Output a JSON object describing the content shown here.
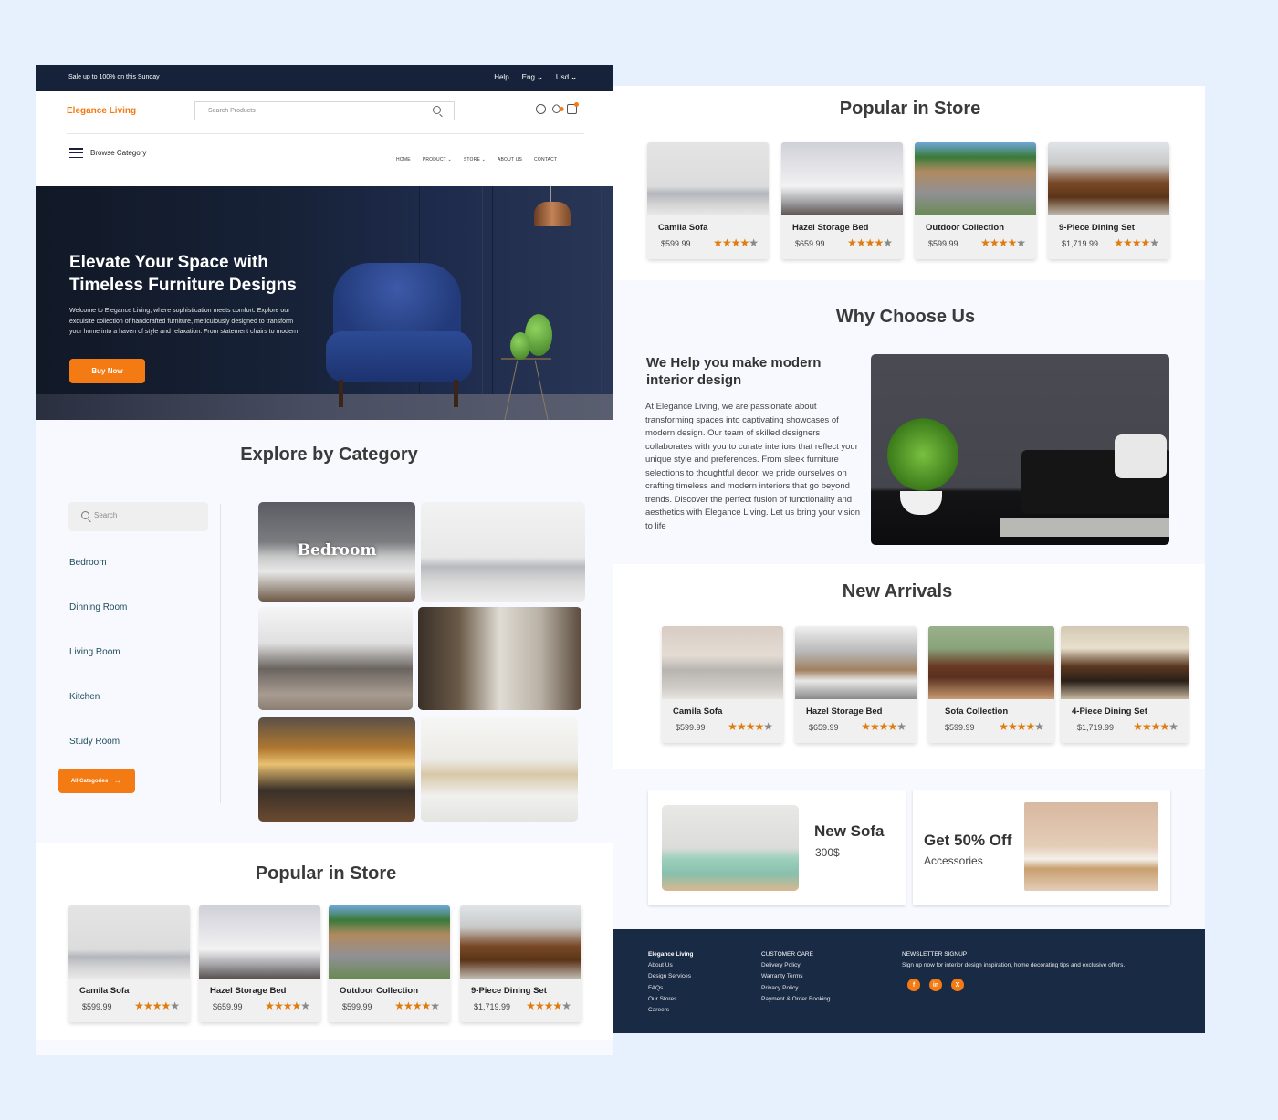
{
  "topbar": {
    "promo": "Sale up to 100% on this Sunday",
    "help": "Help",
    "language": "Eng",
    "currency": "Usd"
  },
  "header": {
    "logo": "Elegance Living",
    "search_placeholder": "Search Products",
    "browse": "Browse Category",
    "nav": [
      {
        "label": "HOME",
        "dropdown": false
      },
      {
        "label": "PRODUCT",
        "dropdown": true
      },
      {
        "label": "STORE",
        "dropdown": true
      },
      {
        "label": "ABOUT US",
        "dropdown": false
      },
      {
        "label": "CONTACT",
        "dropdown": false
      }
    ],
    "icons": [
      "user-icon",
      "heart-icon",
      "bag-icon"
    ]
  },
  "hero": {
    "title": "Elevate Your Space with Timeless Furniture Designs",
    "description": "Welcome to Elegance Living, where sophistication meets comfort. Explore our exquisite collection of handcrafted furniture, meticulously designed to transform your home into a haven of style and relaxation. From statement chairs to modern",
    "cta": "Buy Now"
  },
  "categories": {
    "title": "Explore by Category",
    "search_placeholder": "Search",
    "items": [
      "Bedroom",
      "Dinning Room",
      "Living Room",
      "Kitchen",
      "Study Room"
    ],
    "button": "All Categories",
    "tile_label": "Bedroom"
  },
  "popular": {
    "title": "Popular in Store",
    "products": [
      {
        "name": "Camila Sofa",
        "price": "$599.99",
        "rating": 4
      },
      {
        "name": "Hazel Storage Bed",
        "price": "$659.99",
        "rating": 4
      },
      {
        "name": "Outdoor Collection",
        "price": "$599.99",
        "rating": 4
      },
      {
        "name": "9-Piece Dining Set",
        "price": "$1,719.99",
        "rating": 4
      }
    ]
  },
  "why": {
    "title": "Why Choose Us",
    "heading": "We Help you make modern interior design",
    "body": "At Elegance Living, we are passionate about transforming spaces into captivating showcases of modern design. Our team of skilled designers collaborates with you to curate interiors that reflect your unique style and preferences. From sleek furniture selections to thoughtful decor, we pride ourselves on crafting timeless and modern interiors that go beyond trends. Discover the perfect fusion of functionality and aesthetics with Elegance Living. Let us bring your vision to life"
  },
  "arrivals": {
    "title": "New Arrivals",
    "products": [
      {
        "name": "Camila Sofa",
        "price": "$599.99",
        "rating": 4
      },
      {
        "name": "Hazel Storage Bed",
        "price": "$659.99",
        "rating": 4
      },
      {
        "name": "Sofa Collection",
        "price": "$599.99",
        "rating": 4
      },
      {
        "name": "4-Piece Dining Set",
        "price": "$1,719.99",
        "rating": 4
      }
    ]
  },
  "promos": [
    {
      "title": "New Sofa",
      "subtitle": "300$"
    },
    {
      "title": "Get 50% Off",
      "subtitle": "Accessories"
    }
  ],
  "footer": {
    "brand": "Elegance Living",
    "company_links": [
      "About Us",
      "Design Services",
      "FAQs",
      "Our Stores",
      "Careers"
    ],
    "care_title": "CUSTOMER CARE",
    "care_links": [
      "Delivery Policy",
      "Warranty Terms",
      "Privacy Policy",
      "Payment & Order Booking"
    ],
    "newsletter_title": "NEWSLETTER SIGNUP",
    "newsletter_text": "Sign up now for interior design inspiration, home decorating tips and exclusive offers.",
    "social": [
      {
        "name": "facebook",
        "glyph": "f"
      },
      {
        "name": "linkedin",
        "glyph": "in"
      },
      {
        "name": "x",
        "glyph": "X"
      }
    ]
  },
  "colors": {
    "accent": "#f47a14",
    "navy": "#15223a",
    "footer": "#192a45",
    "star": "#e07b0e"
  }
}
